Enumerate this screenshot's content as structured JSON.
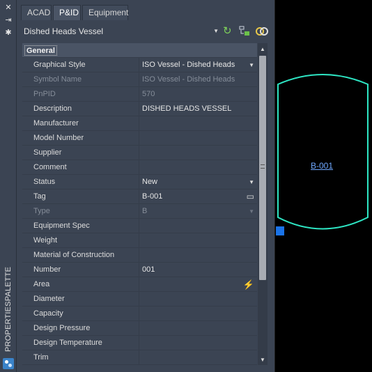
{
  "titlebar": {
    "close_glyph": "✕",
    "autohide_glyph": "⇥",
    "properties_glyph": "✱",
    "title": "PROPERTIESPALETTE"
  },
  "tabs": [
    {
      "label": "ACAD",
      "active": false
    },
    {
      "label": "P&ID",
      "active": true
    },
    {
      "label": "Equipment",
      "active": false
    }
  ],
  "selector": {
    "value": "Dished Heads Vessel",
    "arrow": "▼",
    "icons": [
      "refresh-icon",
      "quick-select-icon",
      "toggle-pickadd-icon"
    ]
  },
  "grid": {
    "category": "General",
    "rows": [
      {
        "label": "Graphical Style",
        "value": "ISO Vessel - Dished Heads",
        "control": "▼",
        "disabled": false
      },
      {
        "label": "Symbol Name",
        "value": "ISO Vessel - Dished Heads",
        "control": "",
        "disabled": true
      },
      {
        "label": "PnPID",
        "value": "570",
        "control": "",
        "disabled": true
      },
      {
        "label": "Description",
        "value": "DISHED HEADS VESSEL",
        "control": "",
        "disabled": false
      },
      {
        "label": "Manufacturer",
        "value": "",
        "control": "",
        "disabled": false
      },
      {
        "label": "Model Number",
        "value": "",
        "control": "",
        "disabled": false
      },
      {
        "label": "Supplier",
        "value": "",
        "control": "",
        "disabled": false
      },
      {
        "label": "Comment",
        "value": "",
        "control": "",
        "disabled": false
      },
      {
        "label": "Status",
        "value": "New",
        "control": "▼",
        "disabled": false
      },
      {
        "label": "Tag",
        "value": "B-001",
        "control": "▭",
        "disabled": false
      },
      {
        "label": "Type",
        "value": "B",
        "control": "▼",
        "disabled": true
      },
      {
        "label": "Equipment Spec",
        "value": "",
        "control": "",
        "disabled": false
      },
      {
        "label": "Weight",
        "value": "",
        "control": "",
        "disabled": false
      },
      {
        "label": "Material of Construction",
        "value": "",
        "control": "",
        "disabled": false
      },
      {
        "label": "Number",
        "value": "001",
        "control": "",
        "disabled": false
      },
      {
        "label": "Area",
        "value": "",
        "control": "⚡",
        "disabled": false
      },
      {
        "label": "Diameter",
        "value": "",
        "control": "",
        "disabled": false
      },
      {
        "label": "Capacity",
        "value": "",
        "control": "",
        "disabled": false
      },
      {
        "label": "Design Pressure",
        "value": "",
        "control": "",
        "disabled": false
      },
      {
        "label": "Design Temperature",
        "value": "",
        "control": "",
        "disabled": false
      },
      {
        "label": "Trim",
        "value": "",
        "control": "",
        "disabled": false
      }
    ]
  },
  "scrollbar": {
    "up": "▲",
    "down": "▼"
  },
  "canvas": {
    "vessel_tag": "B-001",
    "vessel_color": "#2ee6c4",
    "grip_color": "#1a73e8"
  }
}
